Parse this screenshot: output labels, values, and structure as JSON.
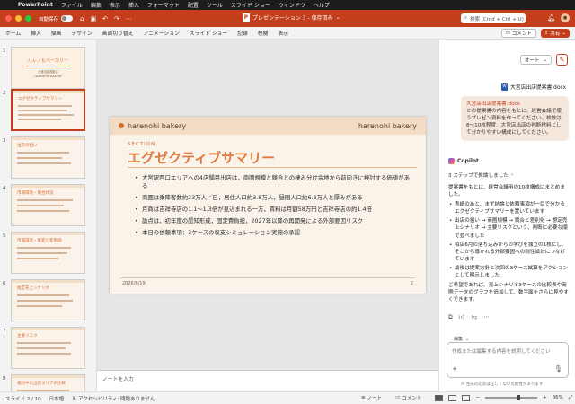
{
  "menubar": {
    "items": [
      "PowerPoint",
      "ファイル",
      "編集",
      "表示",
      "挿入",
      "フォーマット",
      "配置",
      "ツール",
      "スライド ショー",
      "ウィンドウ",
      "ヘルプ"
    ]
  },
  "titlebar": {
    "autosave_label": "自動保存",
    "document_title": "プレゼンテーション 3 - 保存済み",
    "search_placeholder": "検索 (Cmd + Ctrl + U)"
  },
  "ribbon": {
    "tabs": [
      "ホーム",
      "挿入",
      "描画",
      "デザイン",
      "画面切り替え",
      "アニメーション",
      "スライド ショー",
      "記録",
      "校閲",
      "表示"
    ],
    "comment_label": "コメント",
    "share_label": "共有"
  },
  "thumbnails": {
    "numbers": [
      "1",
      "2",
      "3",
      "4",
      "5",
      "6",
      "7",
      "8"
    ],
    "cover_title": "ハレノヒベーカリー",
    "cover_subtitle": "大宮出店提案書",
    "cover_caption": "HARENOHI BAKERY",
    "slide_titles": [
      "",
      "エグゼクティブサマリー",
      "出店の狙い",
      "市場環境・競合状況",
      "市場環境・集客と客単価",
      "推定売上シナリオ",
      "主要リスク",
      "検討中の出店エリアの比較"
    ]
  },
  "slide": {
    "brand_left": "harenohi bakery",
    "brand_right": "harenohi bakery",
    "section_label": "SECTION",
    "title": "エグゼクティブサマリー",
    "bullets": [
      "大宮駅西口エリアへの4店舗目出店は，商圏規模と競合との棲み分け余地から前向きに検討する価値がある",
      "商圏は乗降客数約23万人／日，居住人口約3.8万人，昼間人口約6.2万人と厚みがある",
      "月商は吉祥寺店の1.1〜1.3倍が見込まれる一方，賃料は月額58万円と吉祥寺店の約1.4倍",
      "論点は，初年度の認知形成，固定費負担，2027年以降の再開発による外部要因リスク",
      "本日の依頼事項：3ケースの収支シミュレーション実施の承認"
    ],
    "date": "2026/8/19",
    "page": "2"
  },
  "notes": {
    "placeholder": "ノートを入力"
  },
  "copilot": {
    "mode_label": "オート",
    "attached_doc": "大宮店出店提案書.docx",
    "user_message_link": "大宮店出店提案書.docx",
    "user_message": "この提案書の内容をもとに、経営会議で使うプレゼン資料を作ってください。枚数は8〜10枚程度、大宮店出店の判断材料として分かりやすい構成にしてください。",
    "assistant_name": "Copilot",
    "steps_label": "3 ステップで推論しました",
    "answer_intro": "提案書をもとに、経営会議用の10枚構成にまとめました。",
    "answer_bullets": [
      "表紙のあと、まず結論と依頼事項が一目で分かるエグゼクティブサマリーを置いています",
      "出店の狙い → 商圏規模 → 競合と差別化 → 想定売上シナリオ → 主要リスクという、判断に必要な順で並べました",
      "柏店6月の落ち込みからの学びを独立の1枚にし、そこから導かれる外部要因への耐性設計につなげています",
      "最後は提案方針と次回の3ケース試算をアクションとして明示しました"
    ],
    "answer_after": "ご希望であれば、売上シナリオ3ケースの比較表や商圏データのグラフを追加して、数字面をさらに見やすくできます。",
    "hint_label": "編集",
    "input_placeholder": "作成または編集する内容を説明してください",
    "disclaimer": "AI 生成の応答は正しくない可能性があります"
  },
  "statusbar": {
    "slide_counter": "スライド 2 / 10",
    "language": "日本語",
    "accessibility": "アクセシビリティ: 問題ありません",
    "notes_label": "ノート",
    "comments_label": "コメント",
    "zoom": "86%",
    "zoom_fraction": 0.62
  },
  "colors": {
    "accent": "#c43e1c",
    "slide_orange": "#e07a3e",
    "slide_bg": "#faf3ea"
  }
}
